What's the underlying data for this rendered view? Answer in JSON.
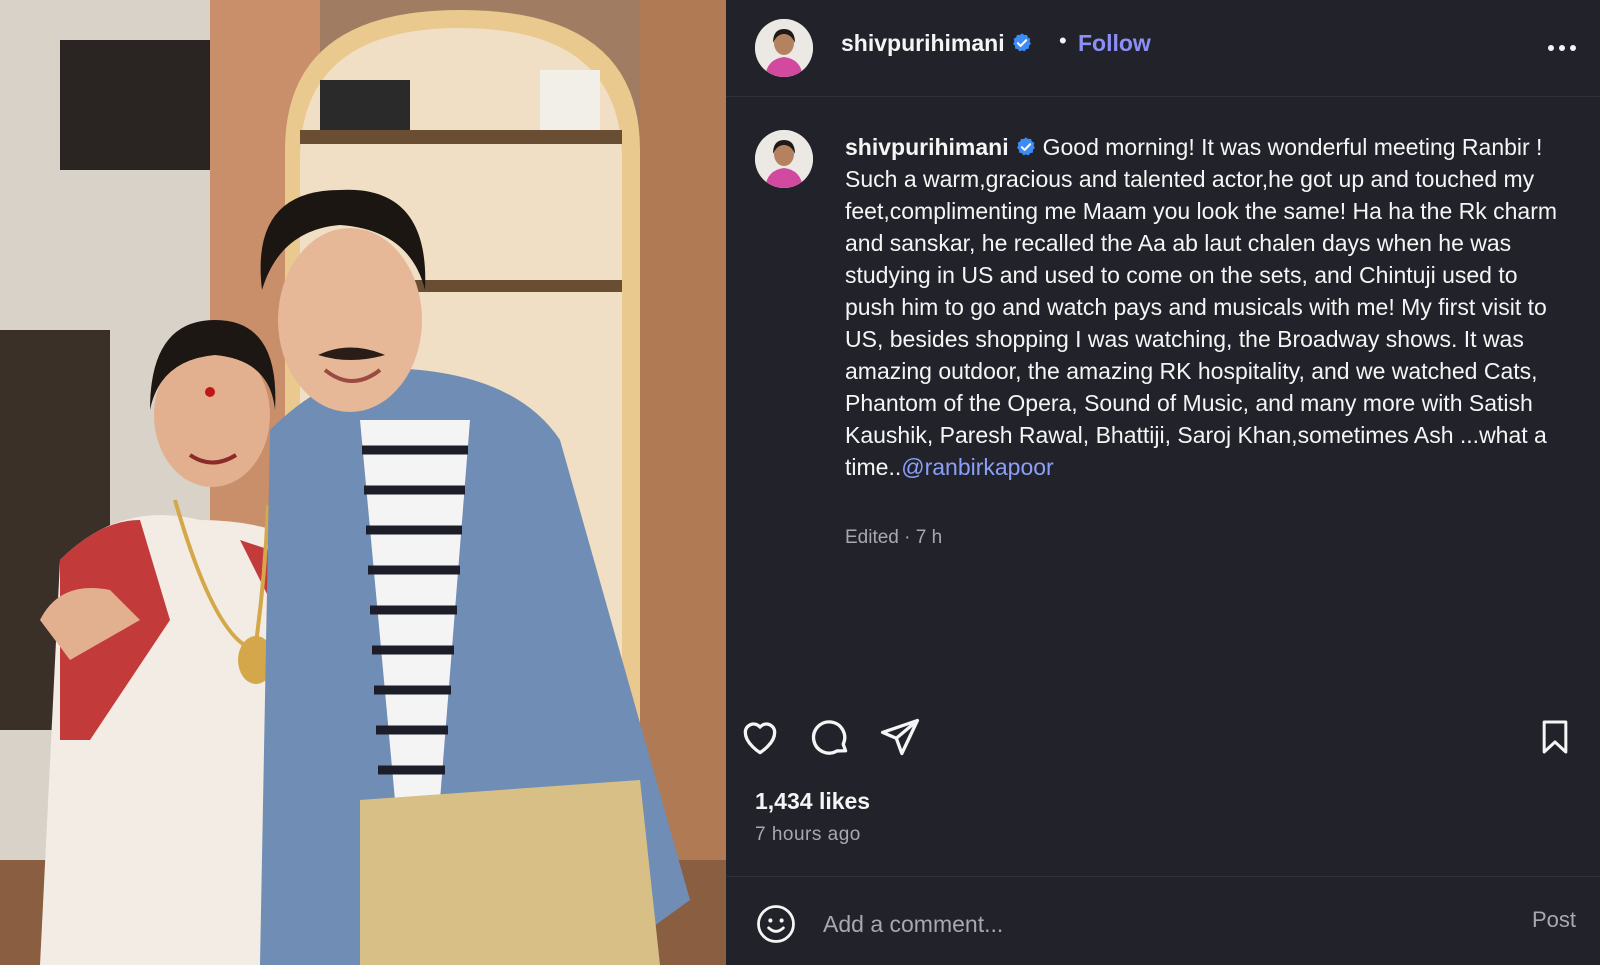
{
  "post": {
    "username": "shivpurihimani",
    "follow_label": "Follow",
    "separator": "•",
    "photo_alt": "Photo of two people smiling",
    "caption_text": "Good morning! It was wonderful meeting Ranbir ! Such a warm,gracious and talented actor,he got up and touched my feet,complimenting me Maam you look the same! Ha ha the Rk charm and sanskar, he recalled the Aa ab laut chalen days when he was studying in US and used to come on the sets, and Chintuji used to push him to go and watch pays and musicals with me! My first visit to US, besides shopping I was watching, the Broadway shows. It was amazing outdoor, the amazing RK hospitality, and we watched Cats, Phantom of the Opera, Sound of Music, and many more with Satish Kaushik, Paresh Rawal, Bhattiji, Saroj Khan,sometimes Ash ...what a time..",
    "mention": "@ranbirkapoor",
    "edited_meta": "Edited · 7 h",
    "likes": "1,434 likes",
    "time_ago": "7 hours ago"
  },
  "comment": {
    "placeholder": "Add a comment...",
    "post_label": "Post"
  },
  "icons": {
    "like": "heart-icon",
    "comment": "comment-icon",
    "share": "share-icon",
    "save": "bookmark-icon",
    "emoji": "emoji-icon",
    "more": "more-icon",
    "verified": "verified-badge-icon"
  },
  "colors": {
    "background": "#22232a",
    "follow": "#8b8ff6",
    "mention": "#8b9ff8",
    "verified": "#3d8bf5",
    "muted_text": "#a8a8b0"
  }
}
